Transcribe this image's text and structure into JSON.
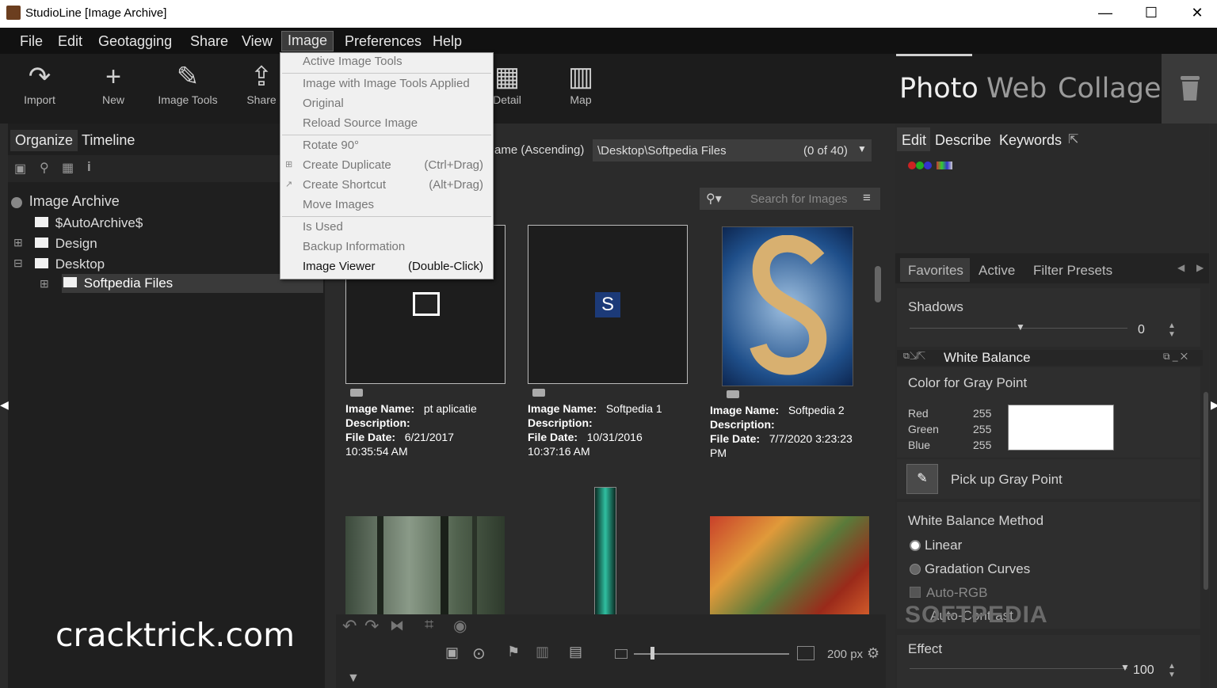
{
  "window": {
    "title": "StudioLine [Image Archive]",
    "minimize": "—",
    "maximize": "☐",
    "close": "✕"
  },
  "menubar": [
    "File",
    "Edit",
    "Geotagging",
    "Share",
    "View",
    "Image",
    "Preferences",
    "Help"
  ],
  "toolbar": {
    "buttons": [
      {
        "label": "Import",
        "icon": "↷"
      },
      {
        "label": "New",
        "icon": "+"
      },
      {
        "label": "Image Tools",
        "icon": "✎"
      },
      {
        "label": "Share",
        "icon": "⇪"
      },
      {
        "label": "Detail",
        "icon": "▦"
      },
      {
        "label": "Map",
        "icon": "▥"
      }
    ],
    "modes": [
      "Photo",
      "Web",
      "Collage"
    ]
  },
  "left": {
    "tabs": [
      "Organize",
      "Timeline"
    ],
    "tree": {
      "root": "Image Archive",
      "items": [
        "$AutoArchive$",
        "Design",
        "Desktop",
        "Softpedia Files"
      ]
    }
  },
  "center": {
    "sort": "ame (Ascending)",
    "path": "\\Desktop\\Softpedia Files",
    "count": "(0 of 40)",
    "search_placeholder": "Search for Images",
    "labels": {
      "name": "Image Name:",
      "desc": "Description:",
      "date": "File Date:"
    },
    "images": [
      {
        "name": "pt aplicatie",
        "date": "6/21/2017",
        "time": "10:35:54 AM"
      },
      {
        "name": "Softpedia 1",
        "date": "10/31/2016",
        "time": "10:37:16 AM"
      },
      {
        "name": "Softpedia 2",
        "date": "7/7/2020 3:23:23",
        "time": "PM"
      }
    ],
    "zoom": "200 px"
  },
  "right": {
    "tabs": [
      "Edit",
      "Describe",
      "Keywords"
    ],
    "preset_tabs": [
      "Favorites",
      "Active",
      "Filter Presets"
    ],
    "shadows": {
      "label": "Shadows",
      "value": "0"
    },
    "white_balance": {
      "title": "White Balance",
      "gray_label": "Color for Gray Point",
      "red_label": "Red",
      "red": "255",
      "green_label": "Green",
      "green": "255",
      "blue_label": "Blue",
      "blue": "255",
      "pick": "Pick up Gray Point",
      "method_label": "White Balance Method",
      "linear": "Linear",
      "gradation": "Gradation Curves",
      "auto_rgb": "Auto-RGB",
      "auto_contrast": "Auto-Contrast"
    },
    "effect": {
      "label": "Effect",
      "value": "100"
    }
  },
  "menu": {
    "items": [
      {
        "label": "Active Image Tools",
        "shortcut": ""
      },
      {
        "label": "Image with Image Tools Applied",
        "shortcut": ""
      },
      {
        "label": "Original",
        "shortcut": ""
      },
      {
        "label": "Reload Source Image",
        "shortcut": ""
      },
      {
        "label": "Rotate 90°",
        "shortcut": ""
      },
      {
        "label": "Create Duplicate",
        "shortcut": "(Ctrl+Drag)"
      },
      {
        "label": "Create Shortcut",
        "shortcut": "(Alt+Drag)"
      },
      {
        "label": "Move Images",
        "shortcut": ""
      },
      {
        "label": "Is Used",
        "shortcut": ""
      },
      {
        "label": "Backup Information",
        "shortcut": ""
      },
      {
        "label": "Image Viewer",
        "shortcut": "(Double-Click)"
      }
    ]
  },
  "watermark": "cracktrick.com",
  "watermark2": "SOFTPEDIA"
}
